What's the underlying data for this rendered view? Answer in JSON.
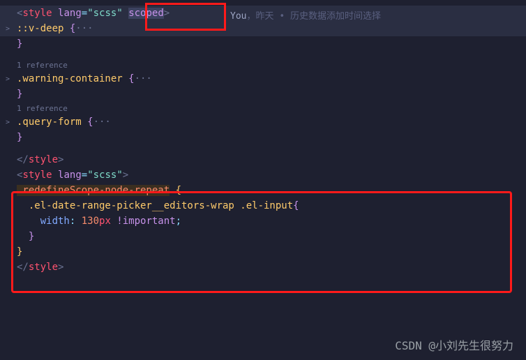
{
  "blame": {
    "author": "You",
    "sep": "，",
    "when": "昨天",
    "bullet": "•",
    "msg": "历史数据添加时间选择"
  },
  "codelens": {
    "ref1": "1 reference",
    "ref2": "1 reference"
  },
  "code": {
    "l1_tag": "style",
    "l1_attr1": "lang",
    "l1_str1": "\"scss\"",
    "l1_attr2": "scoped",
    "l2_sel": "::v-deep",
    "l2_brace": " {",
    "l2_dots": "···",
    "l3_brace": "}",
    "l4_sel": ".warning-container",
    "l4_brace": " {",
    "l4_dots": "···",
    "l5_brace": "}",
    "l6_sel": ".query-form",
    "l6_brace": " {",
    "l6_dots": "···",
    "l7_brace": "}",
    "l8_close_tag": "style",
    "l9_tag": "style",
    "l9_attr1": "lang",
    "l9_str1": "\"scss\"",
    "l10_sel": ".redefineScope-node-repeat",
    "l10_brace": " {",
    "l11_sel": "  .el-date-range-picker__editors-wrap .el-input",
    "l11_brace": "{",
    "l12_prop": "    width",
    "l12_colon": ": ",
    "l12_num": "130",
    "l12_unit": "px",
    "l12_imp": " !important",
    "l12_semi": ";",
    "l13_brace": "  }",
    "l14_brace": "}",
    "l15_close_tag": "style"
  },
  "watermark": "CSDN @小刘先生很努力"
}
